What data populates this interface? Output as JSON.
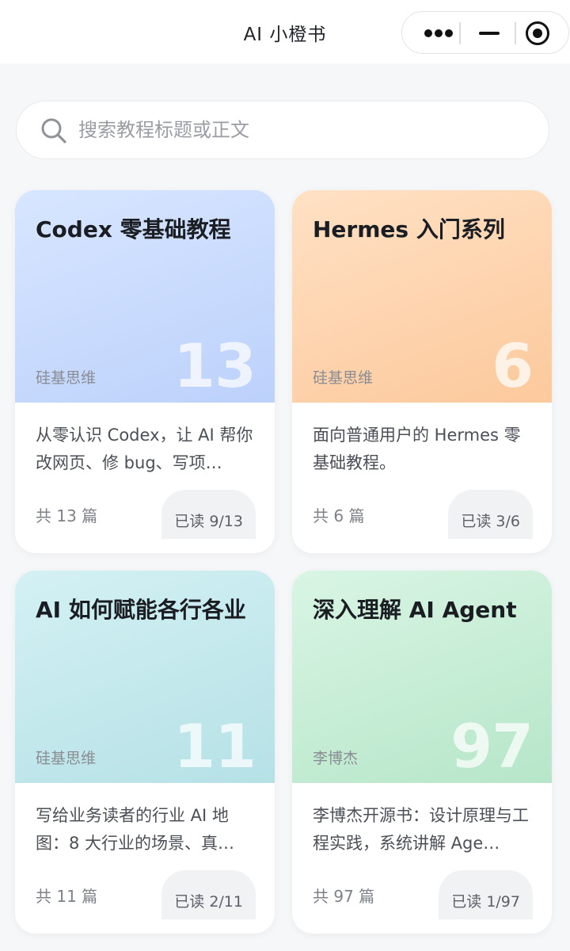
{
  "nav": {
    "title": "AI 小橙书"
  },
  "search": {
    "placeholder": "搜索教程标题或正文"
  },
  "cards": [
    {
      "title": "Codex 零基础教程",
      "author": "硅基思维",
      "number": "13",
      "description": "从零认识 Codex，让 AI 帮你改网页、修 bug、写项…",
      "count": "共 13 篇",
      "read": "已读 9/13",
      "color": "#c4d7fc"
    },
    {
      "title": "Hermes 入门系列",
      "author": "硅基思维",
      "number": "6",
      "description": "面向普通用户的 Hermes 零基础教程。",
      "count": "共 6 篇",
      "read": "已读 3/6",
      "color": "#fdd0a6"
    },
    {
      "title": "AI 如何赋能各行各业",
      "author": "硅基思维",
      "number": "11",
      "description": "写给业务读者的行业 AI 地图：8 大行业的场景、真…",
      "count": "共 11 篇",
      "read": "已读 2/11",
      "color": "#bde5ea"
    },
    {
      "title": "深入理解 AI Agent",
      "author": "李博杰",
      "number": "97",
      "description": "李博杰开源书：设计原理与工程实践，系统讲解 Age…",
      "count": "共 97 篇",
      "read": "已读 1/97",
      "color": "#bdeacf"
    }
  ]
}
